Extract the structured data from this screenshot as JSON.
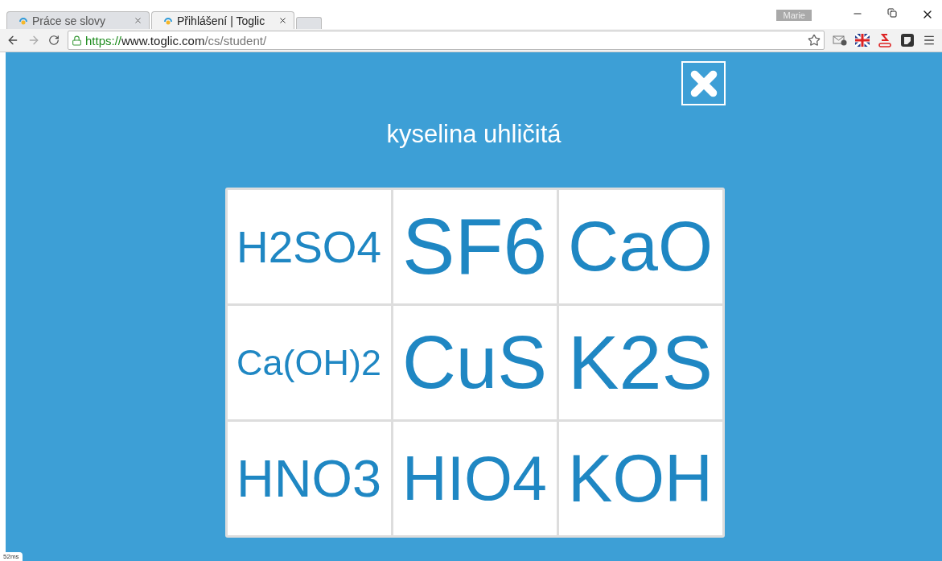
{
  "browser": {
    "tabs": [
      {
        "title": "Práce se slovy",
        "selected": false
      },
      {
        "title": "Přihlášení | Toglic",
        "selected": true
      }
    ],
    "profile": "Marie",
    "url": {
      "scheme": "https://",
      "host": "www.toglic.com",
      "path": "/cs/student/"
    }
  },
  "quiz": {
    "prompt": "kyselina uhličitá",
    "options": [
      "H2SO4",
      "SF6",
      "CaO",
      "Ca(OH)2",
      "CuS",
      "K2S",
      "HNO3",
      "HIO4",
      "KOH"
    ]
  },
  "timing": "52ms"
}
